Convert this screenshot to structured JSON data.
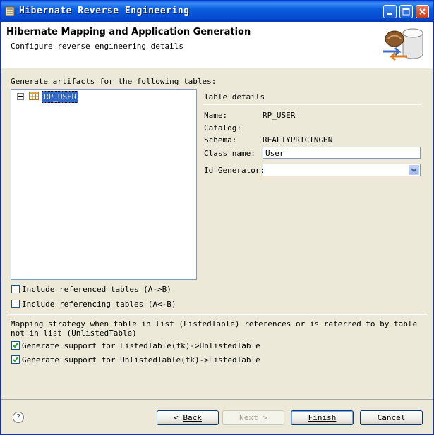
{
  "window": {
    "title": "Hibernate Reverse Engineering",
    "controls": [
      "minimize-icon",
      "maximize-icon",
      "close-icon"
    ]
  },
  "header": {
    "title": "Hibernate Mapping and Application Generation",
    "subtitle": "Configure reverse engineering details",
    "image": "database-mapping-icon"
  },
  "tables": {
    "label": "Generate artifacts for the following tables:",
    "items": [
      {
        "label": "RP_USER",
        "icon": "table-icon",
        "expanded": false,
        "selected": true
      }
    ]
  },
  "details": {
    "heading": "Table details",
    "name_label": "Name:",
    "name_value": "RP_USER",
    "catalog_label": "Catalog:",
    "catalog_value": "",
    "schema_label": "Schema:",
    "schema_value": "REALTYPRICINGHN",
    "class_label": "Class name:",
    "class_value": "User",
    "idgen_label": "Id Generator:",
    "idgen_value": ""
  },
  "options": {
    "include_referenced": {
      "label": "Include referenced tables (A->B)",
      "checked": false
    },
    "include_referencing": {
      "label": "Include referencing tables (A<-B)",
      "checked": false
    },
    "mapping_strategy": "Mapping strategy when table in list (ListedTable) references or is referred to by table not in list (UnlistedTable)",
    "support_listed_to_unlisted": {
      "label": "Generate support for ListedTable(fk)->UnlistedTable",
      "checked": true
    },
    "support_unlisted_to_listed": {
      "label": "Generate support for UnlistedTable(fk)->ListedTable",
      "checked": true
    }
  },
  "footer": {
    "help_label": "?",
    "back_label": "Back",
    "next_label": "Next",
    "finish_label": "Finish",
    "cancel_label": "Cancel"
  },
  "colors": {
    "titlebar": "#0a5ee0",
    "selection": "#316ac5",
    "dialog_bg": "#ece9d8",
    "checkbox_check": "#21a121"
  }
}
